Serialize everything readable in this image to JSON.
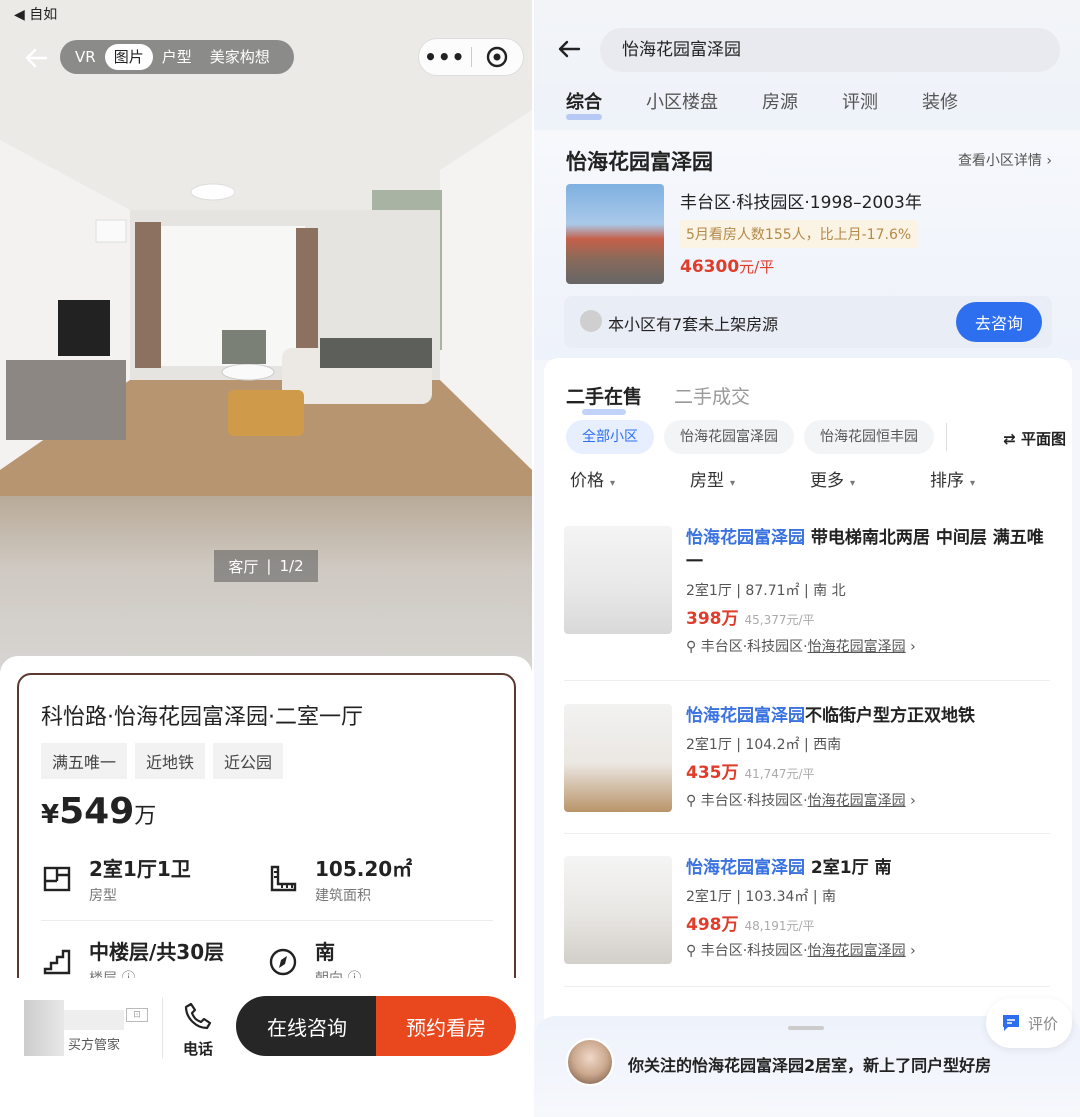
{
  "left": {
    "status": {
      "back_label": "◀ 自如"
    },
    "media_tabs": [
      "VR",
      "图片",
      "户型",
      "美家构想"
    ],
    "media_tab_active": 1,
    "photo_counter": {
      "room": "客厅",
      "index": "1/2"
    },
    "listing": {
      "title": "科怡路·怡海花园富泽园·二室一厅",
      "tags": [
        "满五唯一",
        "近地铁",
        "近公园"
      ],
      "price": {
        "currency": "¥",
        "amount": "549",
        "unit": "万"
      },
      "facts": [
        {
          "value": "2室1厅1卫",
          "label": "房型",
          "icon": "floorplan-icon"
        },
        {
          "value": "105.20㎡",
          "label": "建筑面积",
          "icon": "ruler-icon"
        },
        {
          "value": "中楼层/共30层",
          "label": "楼层 ⓘ",
          "icon": "stairs-icon"
        },
        {
          "value": "南",
          "label": "朝向 ⓘ",
          "icon": "compass-icon"
        }
      ]
    },
    "bottom_bar": {
      "agent_label": "买方管家",
      "phone_label": "电话",
      "consult_label": "在线咨询",
      "book_label": "预约看房"
    }
  },
  "right": {
    "search": {
      "value": "怡海花园富泽园"
    },
    "tabs": [
      "综合",
      "小区楼盘",
      "房源",
      "评测",
      "装修"
    ],
    "tab_active": 0,
    "community": {
      "name": "怡海花园富泽园",
      "detail_link": "查看小区详情 ›",
      "meta": "丰台区·科技园区·1998–2003年",
      "hot": "5月看房人数155人，比上月-17.6%",
      "price": "46300",
      "price_unit": "元/平",
      "hidden_text": "本小区有7套未上架房源",
      "ask_label": "去咨询"
    },
    "sub_tabs": [
      "二手在售",
      "二手成交"
    ],
    "chips": [
      "全部小区",
      "怡海花园富泽园",
      "怡海花园恒丰园"
    ],
    "floorplan_label": "⇄ 平面图",
    "filters": [
      "价格",
      "房型",
      "更多",
      "排序"
    ],
    "listings": [
      {
        "highlight": "怡海花园富泽园",
        "title_rest": " 带电梯南北两居 中间层 满五唯一",
        "spec": "2室1厅 | 87.71㎡ | 南 北",
        "price": "398万",
        "unit_price": "45,377元/平",
        "loc_prefix": "丰台区·科技园区·",
        "loc_link": "怡海花园富泽园",
        "loc_suffix": " ›"
      },
      {
        "highlight": "怡海花园富泽园",
        "title_rest": "不临街户型方正双地铁",
        "spec": "2室1厅 | 104.2㎡ | 西南",
        "price": "435万",
        "unit_price": "41,747元/平",
        "loc_prefix": "丰台区·科技园区·",
        "loc_link": "怡海花园富泽园",
        "loc_suffix": " ›"
      },
      {
        "highlight": "怡海花园富泽园",
        "title_rest": " 2室1厅 南",
        "spec": "2室1厅 | 103.34㎡ | 南",
        "price": "498万",
        "unit_price": "48,191元/平",
        "loc_prefix": "丰台区·科技园区·",
        "loc_link": "怡海花园富泽园",
        "loc_suffix": " ›"
      }
    ],
    "recommend_text": "你关注的怡海花园富泽园2居室，新上了同户型好房",
    "feedback_label": "评价",
    "colors": {
      "accent": "#2e6ff0",
      "price_red": "#e03c2c",
      "book_orange": "#e9481f"
    }
  }
}
